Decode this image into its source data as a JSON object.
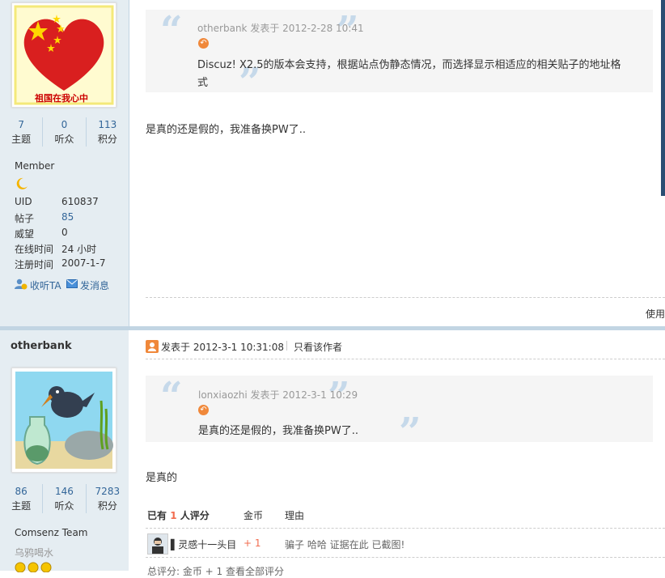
{
  "post1": {
    "avatar_caption": "祖国在我心中",
    "stats": [
      {
        "num": "7",
        "label": "主题"
      },
      {
        "num": "0",
        "label": "听众"
      },
      {
        "num": "113",
        "label": "积分"
      }
    ],
    "group": "Member",
    "info": [
      {
        "key": "UID",
        "val": "610837"
      },
      {
        "key": "帖子",
        "val": "85"
      },
      {
        "key": "威望",
        "val": "0"
      },
      {
        "key": "在线时间",
        "val": "24 小时"
      },
      {
        "key": "注册时间",
        "val": "2007-1-7"
      }
    ],
    "actions": {
      "follow": "收听TA",
      "message": "发消息"
    },
    "quote": {
      "author": "otherbank",
      "meta": " 发表于 2012-2-28 10:41",
      "line1": "Discuz! X2.5的版本会支持，根据站点伪静态情况，而选择显示相适应的相关贴子的地址格",
      "line2": "式"
    },
    "body": "是真的还是假的，我准备换PW了..",
    "footer_right": "使用"
  },
  "post2": {
    "username": "otherbank",
    "stats": [
      {
        "num": "86",
        "label": "主题"
      },
      {
        "num": "146",
        "label": "听众"
      },
      {
        "num": "7283",
        "label": "积分"
      }
    ],
    "group": "Comsenz Team",
    "title": "乌鸦喝水",
    "header": {
      "posted": "发表于 2012-3-1 10:31:08",
      "only_author": "只看该作者"
    },
    "quote": {
      "author": "lonxiaozhi",
      "meta": " 发表于 2012-3-1 10:29",
      "line1": "是真的还是假的，我准备换PW了.."
    },
    "body": "是真的",
    "rating": {
      "prefix": "已有 ",
      "count": "1",
      "suffix": " 人评分",
      "col_coin": "金币",
      "col_reason": "理由",
      "rater": "灵感十一头目",
      "amount": "+ 1",
      "reason": "骗子 哈哈 证据在此 已截图!"
    },
    "partial_bottom": "总评分: 金币 + 1   查看全部评分"
  },
  "colors": {
    "accent_blue": "#336699",
    "sidebar_bg": "#e5edf2",
    "quote_bg": "#f5f5f5",
    "rate_red": "#f26c4f"
  }
}
